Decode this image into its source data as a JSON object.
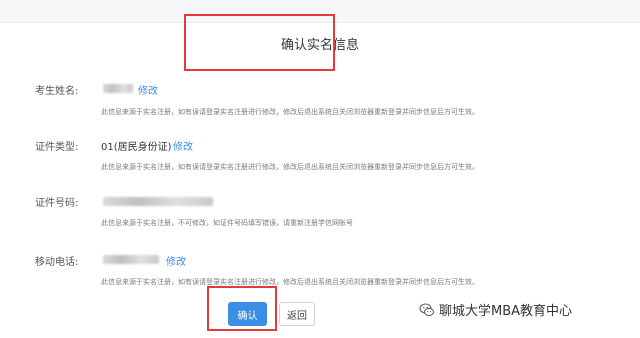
{
  "page": {
    "title": "确认实名信息"
  },
  "fields": {
    "name": {
      "label": "考生姓名:",
      "edit": "修改",
      "hint": "此信息来源于实名注册，如有误请登录实名注册进行修改，修改后退出系统且关闭浏览器重新登录并同步信息后方可生效。"
    },
    "id_type": {
      "label": "证件类型:",
      "value": "01(居民身份证)",
      "edit": "修改",
      "hint": "此信息来源于实名注册，如有误请登录实名注册进行修改，修改后退出系统且关闭浏览器重新登录并同步信息后方可生效。"
    },
    "id_number": {
      "label": "证件号码:",
      "hint": "此信息来源于实名注册，不可修改，如证件号码填写错误，请重新注册学信网账号"
    },
    "phone": {
      "label": "移动电话:",
      "edit": "修改",
      "hint": "此信息来源于实名注册，如有误请登录实名注册进行修改，修改后退出系统且关闭浏览器重新登录并同步信息后方可生效。"
    }
  },
  "actions": {
    "confirm": "确认",
    "back": "返回"
  },
  "watermark": {
    "text": "聊城大学MBA教育中心",
    "icon": "wechat-icon"
  },
  "colors": {
    "accent": "#3a8ee6",
    "highlight": "#e23b3b"
  }
}
